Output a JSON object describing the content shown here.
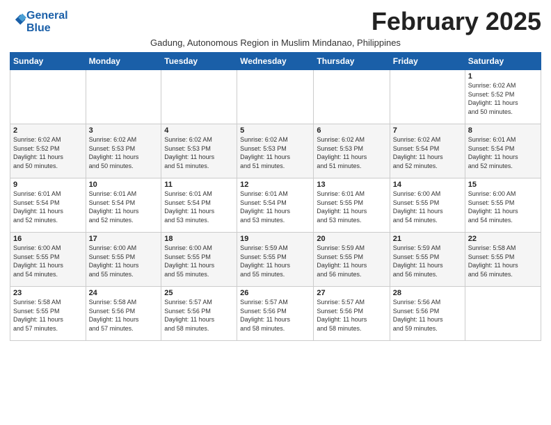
{
  "logo": {
    "line1": "General",
    "line2": "Blue"
  },
  "title": "February 2025",
  "subtitle": "Gadung, Autonomous Region in Muslim Mindanao, Philippines",
  "days_of_week": [
    "Sunday",
    "Monday",
    "Tuesday",
    "Wednesday",
    "Thursday",
    "Friday",
    "Saturday"
  ],
  "weeks": [
    [
      {
        "day": "",
        "info": ""
      },
      {
        "day": "",
        "info": ""
      },
      {
        "day": "",
        "info": ""
      },
      {
        "day": "",
        "info": ""
      },
      {
        "day": "",
        "info": ""
      },
      {
        "day": "",
        "info": ""
      },
      {
        "day": "1",
        "info": "Sunrise: 6:02 AM\nSunset: 5:52 PM\nDaylight: 11 hours\nand 50 minutes."
      }
    ],
    [
      {
        "day": "2",
        "info": "Sunrise: 6:02 AM\nSunset: 5:52 PM\nDaylight: 11 hours\nand 50 minutes."
      },
      {
        "day": "3",
        "info": "Sunrise: 6:02 AM\nSunset: 5:53 PM\nDaylight: 11 hours\nand 50 minutes."
      },
      {
        "day": "4",
        "info": "Sunrise: 6:02 AM\nSunset: 5:53 PM\nDaylight: 11 hours\nand 51 minutes."
      },
      {
        "day": "5",
        "info": "Sunrise: 6:02 AM\nSunset: 5:53 PM\nDaylight: 11 hours\nand 51 minutes."
      },
      {
        "day": "6",
        "info": "Sunrise: 6:02 AM\nSunset: 5:53 PM\nDaylight: 11 hours\nand 51 minutes."
      },
      {
        "day": "7",
        "info": "Sunrise: 6:02 AM\nSunset: 5:54 PM\nDaylight: 11 hours\nand 52 minutes."
      },
      {
        "day": "8",
        "info": "Sunrise: 6:01 AM\nSunset: 5:54 PM\nDaylight: 11 hours\nand 52 minutes."
      }
    ],
    [
      {
        "day": "9",
        "info": "Sunrise: 6:01 AM\nSunset: 5:54 PM\nDaylight: 11 hours\nand 52 minutes."
      },
      {
        "day": "10",
        "info": "Sunrise: 6:01 AM\nSunset: 5:54 PM\nDaylight: 11 hours\nand 52 minutes."
      },
      {
        "day": "11",
        "info": "Sunrise: 6:01 AM\nSunset: 5:54 PM\nDaylight: 11 hours\nand 53 minutes."
      },
      {
        "day": "12",
        "info": "Sunrise: 6:01 AM\nSunset: 5:54 PM\nDaylight: 11 hours\nand 53 minutes."
      },
      {
        "day": "13",
        "info": "Sunrise: 6:01 AM\nSunset: 5:55 PM\nDaylight: 11 hours\nand 53 minutes."
      },
      {
        "day": "14",
        "info": "Sunrise: 6:00 AM\nSunset: 5:55 PM\nDaylight: 11 hours\nand 54 minutes."
      },
      {
        "day": "15",
        "info": "Sunrise: 6:00 AM\nSunset: 5:55 PM\nDaylight: 11 hours\nand 54 minutes."
      }
    ],
    [
      {
        "day": "16",
        "info": "Sunrise: 6:00 AM\nSunset: 5:55 PM\nDaylight: 11 hours\nand 54 minutes."
      },
      {
        "day": "17",
        "info": "Sunrise: 6:00 AM\nSunset: 5:55 PM\nDaylight: 11 hours\nand 55 minutes."
      },
      {
        "day": "18",
        "info": "Sunrise: 6:00 AM\nSunset: 5:55 PM\nDaylight: 11 hours\nand 55 minutes."
      },
      {
        "day": "19",
        "info": "Sunrise: 5:59 AM\nSunset: 5:55 PM\nDaylight: 11 hours\nand 55 minutes."
      },
      {
        "day": "20",
        "info": "Sunrise: 5:59 AM\nSunset: 5:55 PM\nDaylight: 11 hours\nand 56 minutes."
      },
      {
        "day": "21",
        "info": "Sunrise: 5:59 AM\nSunset: 5:55 PM\nDaylight: 11 hours\nand 56 minutes."
      },
      {
        "day": "22",
        "info": "Sunrise: 5:58 AM\nSunset: 5:55 PM\nDaylight: 11 hours\nand 56 minutes."
      }
    ],
    [
      {
        "day": "23",
        "info": "Sunrise: 5:58 AM\nSunset: 5:55 PM\nDaylight: 11 hours\nand 57 minutes."
      },
      {
        "day": "24",
        "info": "Sunrise: 5:58 AM\nSunset: 5:56 PM\nDaylight: 11 hours\nand 57 minutes."
      },
      {
        "day": "25",
        "info": "Sunrise: 5:57 AM\nSunset: 5:56 PM\nDaylight: 11 hours\nand 58 minutes."
      },
      {
        "day": "26",
        "info": "Sunrise: 5:57 AM\nSunset: 5:56 PM\nDaylight: 11 hours\nand 58 minutes."
      },
      {
        "day": "27",
        "info": "Sunrise: 5:57 AM\nSunset: 5:56 PM\nDaylight: 11 hours\nand 58 minutes."
      },
      {
        "day": "28",
        "info": "Sunrise: 5:56 AM\nSunset: 5:56 PM\nDaylight: 11 hours\nand 59 minutes."
      },
      {
        "day": "",
        "info": ""
      }
    ]
  ]
}
